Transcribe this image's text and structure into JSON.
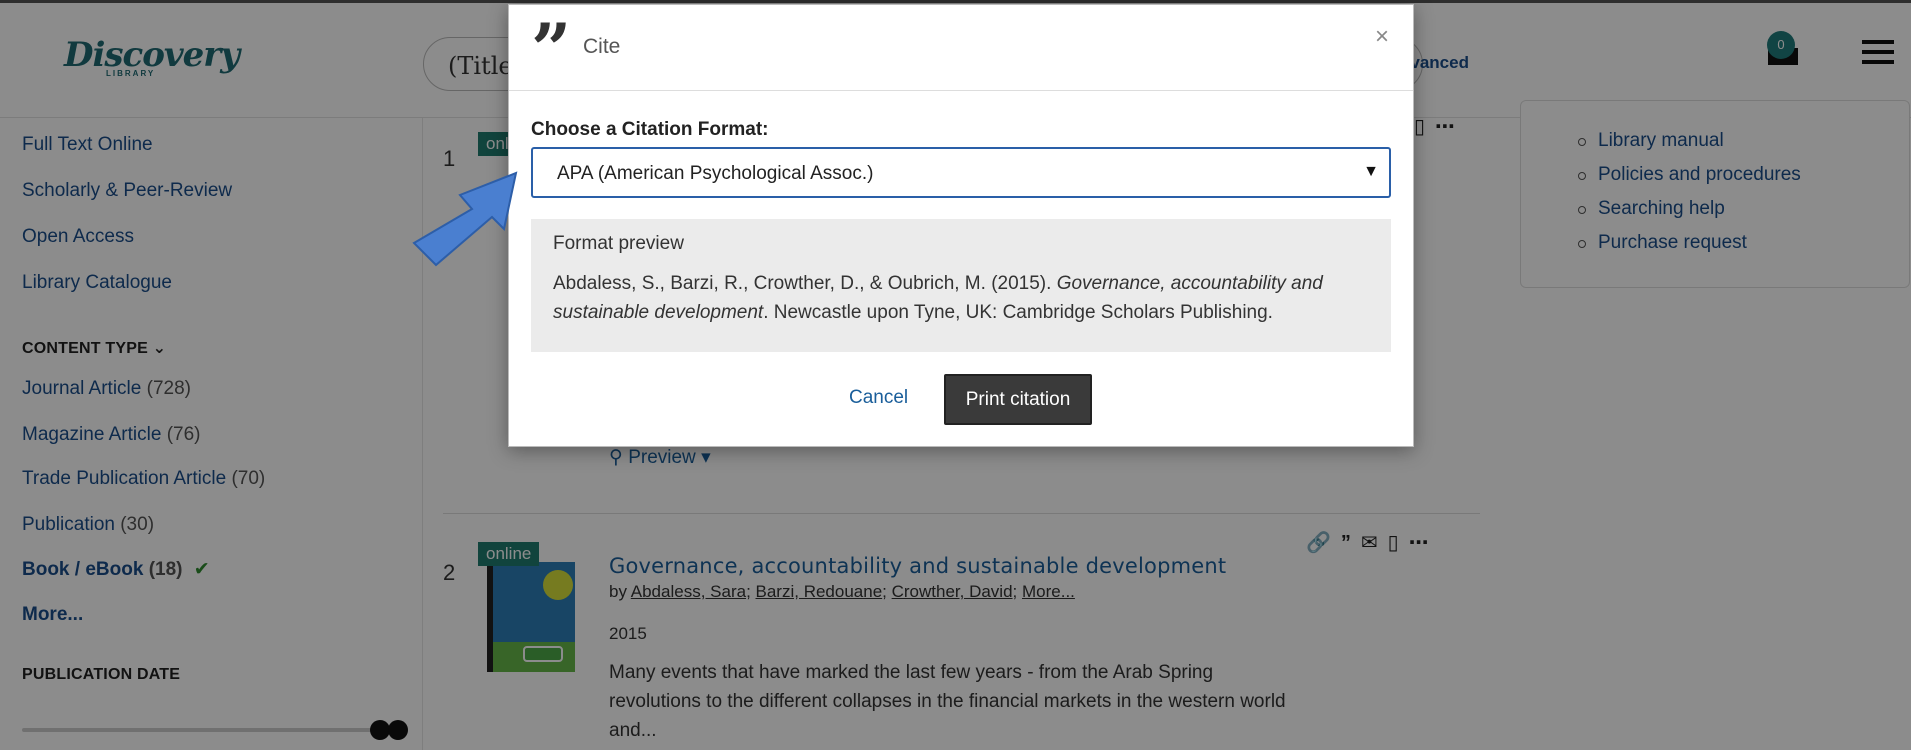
{
  "header": {
    "logo_text": "Discovery",
    "logo_sub": "LIBRARY",
    "search_value": "(TitleC",
    "advanced_label": "dvanced",
    "cart_count": "0"
  },
  "sidebar": {
    "links": [
      {
        "label": "Full Text Online"
      },
      {
        "label": "Scholarly & Peer-Review"
      },
      {
        "label": "Open Access"
      },
      {
        "label": "Library Catalogue"
      }
    ],
    "content_type_heading": "CONTENT TYPE",
    "content_types": [
      {
        "label": "Journal Article",
        "count": "(728)"
      },
      {
        "label": "Magazine Article",
        "count": "(76)"
      },
      {
        "label": "Trade Publication Article",
        "count": "(70)"
      },
      {
        "label": "Publication",
        "count": "(30)"
      },
      {
        "label": "Book / eBook",
        "count": "(18)"
      }
    ],
    "more_label": "More...",
    "publication_date_heading": "PUBLICATION DATE"
  },
  "results": {
    "first_rank": "1",
    "first_tag": "onl",
    "preview_label": "Preview",
    "item2": {
      "rank": "2",
      "tag": "online",
      "title": "Governance, accountability and sustainable development",
      "by": "by",
      "authors": [
        "Abdaless, Sara",
        "Barzi, Redouane",
        "Crowther, David"
      ],
      "more_authors": "More...",
      "year": "2015",
      "snippet": "Many events that have marked the last few years - from the Arab Spring revolutions to the different collapses in the financial markets in the western world and..."
    }
  },
  "right_panel": {
    "links": [
      "Library manual",
      "Policies and procedures",
      "Searching help",
      "Purchase request"
    ]
  },
  "modal": {
    "title": "Cite",
    "choose_label": "Choose a Citation Format:",
    "selected_format": "APA (American Psychological Assoc.)",
    "preview_heading": "Format preview",
    "citation_plain_1": "Abdaless, S., Barzi, R., Crowther, D., & Oubrich, M. (2015). ",
    "citation_italic": "Governance, accountability and sustainable development",
    "citation_plain_2": ". Newcastle upon Tyne, UK: Cambridge Scholars Publishing.",
    "cancel_label": "Cancel",
    "print_label": "Print citation",
    "close_symbol": "×"
  },
  "colors": {
    "link": "#1a4e8a",
    "accent_teal": "#1f7d6f",
    "select_border": "#2a5fa8",
    "arrow_blue": "#4a7fd0",
    "print_button": "#3a3a3a"
  }
}
